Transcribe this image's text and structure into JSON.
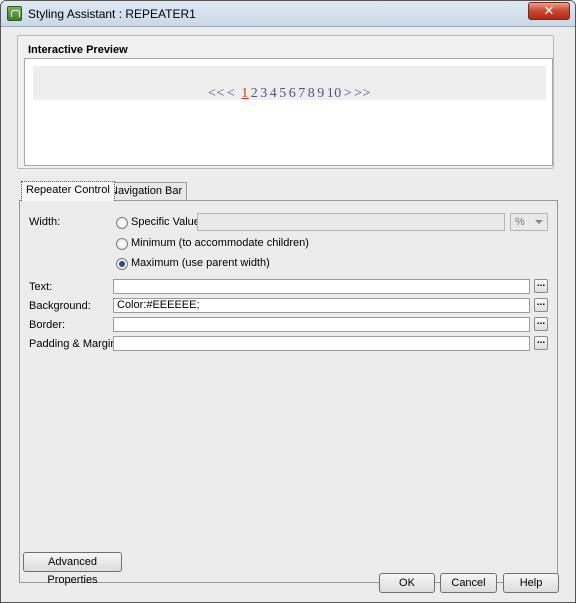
{
  "window": {
    "title": "Styling Assistant : REPEATER1",
    "close_glyph": "✕"
  },
  "preview": {
    "label": "Interactive Preview",
    "background_color": "#EEEEEE",
    "pager": {
      "prev_first": "<<",
      "prev": "<",
      "current": "1",
      "pages": [
        "2",
        "3",
        "4",
        "5",
        "6",
        "7",
        "8",
        "9",
        "10"
      ],
      "next": ">",
      "next_last": ">>"
    }
  },
  "tabs": [
    {
      "label": "Repeater Control",
      "active": true
    },
    {
      "label": "Navigation Bar",
      "active": false
    }
  ],
  "form": {
    "width_label": "Width:",
    "width_options": {
      "specific": "Specific Value",
      "minimum": "Minimum (to accommodate children)",
      "maximum": "Maximum (use parent width)",
      "selected": "maximum"
    },
    "specific_value": "",
    "unit_value": "%",
    "text_label": "Text:",
    "text_value": "",
    "background_label": "Background:",
    "background_value": "Color:#EEEEEE;",
    "border_label": "Border:",
    "border_value": "",
    "padding_label": "Padding & Margin:",
    "padding_value": "",
    "ellipsis": "..."
  },
  "buttons": {
    "advanced": "Advanced Properties",
    "ok": "OK",
    "cancel": "Cancel",
    "help": "Help"
  }
}
